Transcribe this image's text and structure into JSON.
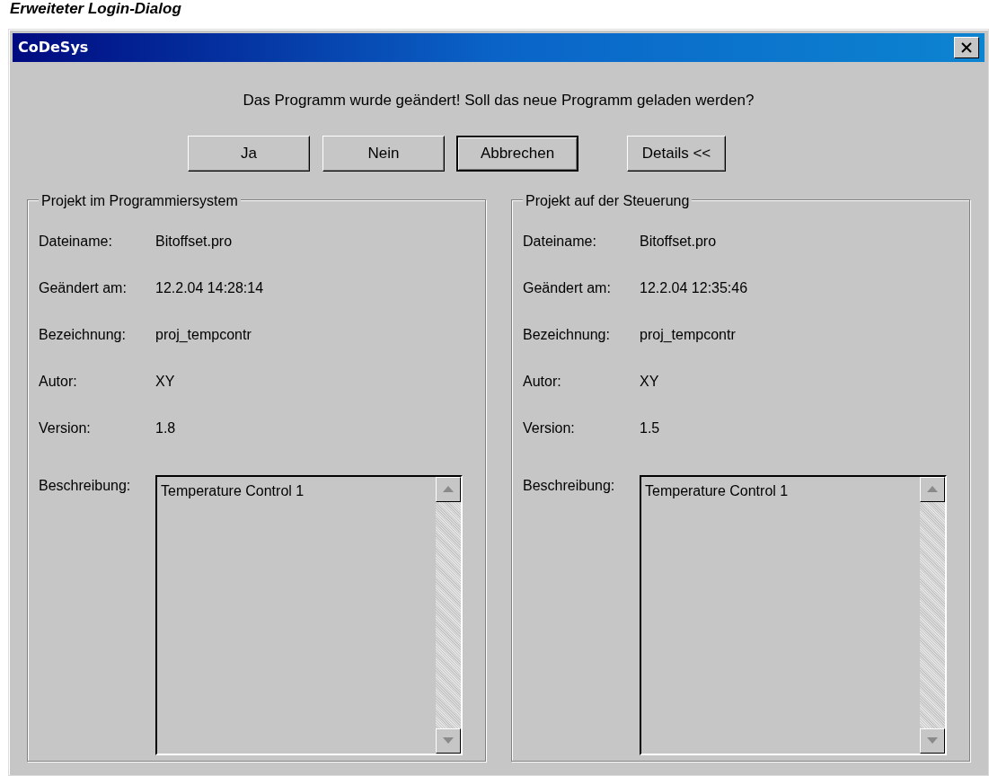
{
  "caption": "Erweiteter Login-Dialog",
  "window": {
    "title": "CoDeSys"
  },
  "message": "Das Programm wurde geändert! Soll das neue Programm geladen werden?",
  "buttons": [
    {
      "label": "Ja",
      "default": false
    },
    {
      "label": "Nein",
      "default": false
    },
    {
      "label": "Abbrechen",
      "default": true
    },
    {
      "label": "Details <<",
      "default": false
    }
  ],
  "groups": [
    {
      "title": "Projekt im Programmiersystem",
      "fields": [
        {
          "label": "Dateiname:",
          "value": "Bitoffset.pro"
        },
        {
          "label": "Geändert am:",
          "value": "12.2.04 14:28:14"
        },
        {
          "label": "Bezeichnung:",
          "value": "proj_tempcontr"
        },
        {
          "label": "Autor:",
          "value": "XY"
        },
        {
          "label": "Version:",
          "value": "1.8"
        }
      ],
      "description": {
        "label": "Beschreibung:",
        "value": "Temperature Control 1"
      }
    },
    {
      "title": "Projekt auf der Steuerung",
      "fields": [
        {
          "label": "Dateiname:",
          "value": "Bitoffset.pro"
        },
        {
          "label": "Geändert am:",
          "value": "12.2.04 12:35:46"
        },
        {
          "label": "Bezeichnung:",
          "value": "proj_tempcontr"
        },
        {
          "label": "Autor:",
          "value": "XY"
        },
        {
          "label": "Version:",
          "value": "1.5"
        }
      ],
      "description": {
        "label": "Beschreibung:",
        "value": "Temperature Control 1"
      }
    }
  ]
}
